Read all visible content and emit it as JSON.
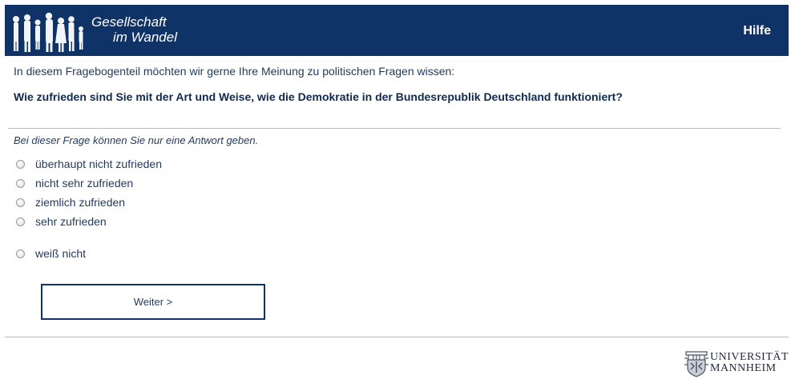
{
  "header": {
    "logo_line1": "Gesellschaft",
    "logo_line2": "im Wandel",
    "help_label": "Hilfe",
    "background_color": "#0f3366"
  },
  "survey": {
    "intro": "In diesem Fragebogenteil möchten wir gerne Ihre Meinung zu politischen Fragen wissen:",
    "question": "Wie zufrieden sind Sie mit der Art und Weise, wie die Demokratie in der Bundesrepublik Deutschland funktioniert?",
    "hint": "Bei dieser Frage können Sie nur eine Antwort geben.",
    "options": [
      {
        "label": "überhaupt nicht zufrieden",
        "selected": false
      },
      {
        "label": "nicht sehr zufrieden",
        "selected": false
      },
      {
        "label": "ziemlich zufrieden",
        "selected": false
      },
      {
        "label": "sehr zufrieden",
        "selected": false
      },
      {
        "label": "weiß nicht",
        "selected": false
      }
    ],
    "next_label": "Weiter >"
  },
  "footer": {
    "university_line1": "UNIVERSITÄT",
    "university_line2": "MANNHEIM",
    "emblem_icon": "university-crest-icon"
  }
}
